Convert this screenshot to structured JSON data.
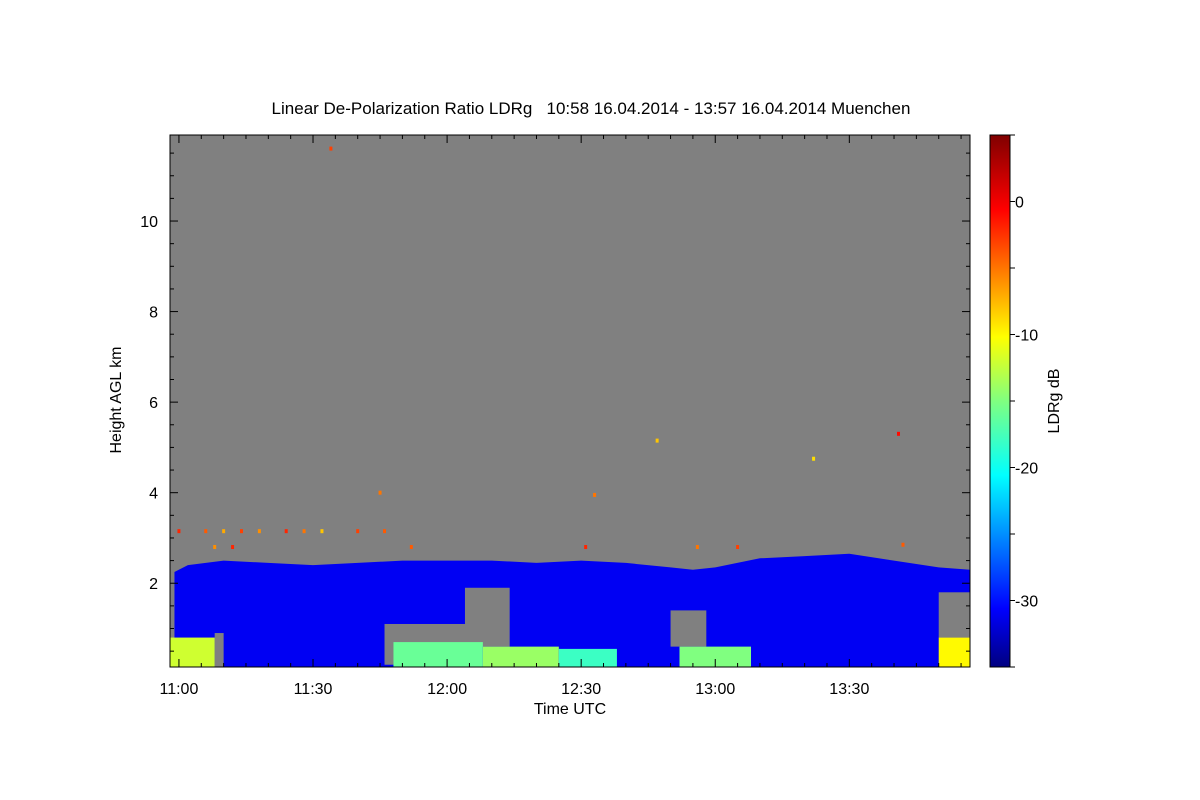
{
  "chart_data": {
    "type": "heatmap",
    "title": "Linear De-Polarization Ratio LDRg   10:58 16.04.2014 - 13:57 16.04.2014 Muenchen",
    "xlabel": "Time UTC",
    "ylabel": "Height AGL km",
    "colorbar_label": "LDRg dB",
    "xlim": [
      "10:58",
      "13:57"
    ],
    "ylim": [
      0.15,
      11.9
    ],
    "x_ticks": [
      "11:00",
      "11:30",
      "12:00",
      "12:30",
      "13:00",
      "13:30"
    ],
    "y_ticks": [
      "2",
      "4",
      "6",
      "8",
      "10"
    ],
    "colorbar_range": [
      -35,
      5
    ],
    "colorbar_ticks": [
      "0",
      "-10",
      "-20",
      "-30"
    ],
    "colormap": "jet",
    "background_color": "#808080",
    "field": {
      "description_units": "LDRg in dB; layer top in km",
      "layer_top_km": [
        {
          "time": "10:58",
          "top": 2.2
        },
        {
          "time": "11:02",
          "top": 2.4
        },
        {
          "time": "11:10",
          "top": 2.5
        },
        {
          "time": "11:20",
          "top": 2.45
        },
        {
          "time": "11:30",
          "top": 2.4
        },
        {
          "time": "11:40",
          "top": 2.45
        },
        {
          "time": "11:50",
          "top": 2.5
        },
        {
          "time": "12:00",
          "top": 2.5
        },
        {
          "time": "12:10",
          "top": 2.5
        },
        {
          "time": "12:20",
          "top": 2.45
        },
        {
          "time": "12:30",
          "top": 2.5
        },
        {
          "time": "12:40",
          "top": 2.45
        },
        {
          "time": "12:50",
          "top": 2.35
        },
        {
          "time": "12:55",
          "top": 2.3
        },
        {
          "time": "13:00",
          "top": 2.35
        },
        {
          "time": "13:10",
          "top": 2.55
        },
        {
          "time": "13:20",
          "top": 2.6
        },
        {
          "time": "13:30",
          "top": 2.65
        },
        {
          "time": "13:40",
          "top": 2.5
        },
        {
          "time": "13:50",
          "top": 2.35
        },
        {
          "time": "13:57",
          "top": 2.3
        }
      ],
      "layer_value_db": -31,
      "surface_layer": [
        {
          "start": "10:58",
          "end": "11:08",
          "top": 0.8,
          "value_db": -12
        },
        {
          "start": "11:48",
          "end": "12:08",
          "top": 0.7,
          "value_db": -16
        },
        {
          "start": "12:08",
          "end": "12:25",
          "top": 0.6,
          "value_db": -14
        },
        {
          "start": "12:25",
          "end": "12:38",
          "top": 0.55,
          "value_db": -18
        },
        {
          "start": "12:52",
          "end": "13:08",
          "top": 0.6,
          "value_db": -15
        },
        {
          "start": "13:50",
          "end": "13:57",
          "top": 0.8,
          "value_db": -10
        }
      ],
      "gaps": [
        {
          "start": "10:58",
          "end": "10:59",
          "bottom": 0.15,
          "top": 2.3
        },
        {
          "start": "11:08",
          "end": "11:10",
          "bottom": 0.15,
          "top": 0.9
        },
        {
          "start": "11:46",
          "end": "12:06",
          "bottom": 0.2,
          "top": 1.1
        },
        {
          "start": "12:04",
          "end": "12:14",
          "bottom": 0.6,
          "top": 1.9
        },
        {
          "start": "12:50",
          "end": "12:58",
          "bottom": 0.6,
          "top": 1.4
        },
        {
          "start": "13:50",
          "end": "13:57",
          "bottom": 0.8,
          "top": 1.8
        }
      ],
      "outliers": [
        {
          "time": "11:34",
          "height": 11.6,
          "value_db": -3
        },
        {
          "time": "12:47",
          "height": 5.15,
          "value_db": -8
        },
        {
          "time": "13:22",
          "height": 4.75,
          "value_db": -9
        },
        {
          "time": "13:41",
          "height": 5.3,
          "value_db": -1
        },
        {
          "time": "11:45",
          "height": 4.0,
          "value_db": -5
        },
        {
          "time": "12:33",
          "height": 3.95,
          "value_db": -5
        },
        {
          "time": "11:00",
          "height": 3.15,
          "value_db": -2
        },
        {
          "time": "11:06",
          "height": 3.15,
          "value_db": -4
        },
        {
          "time": "11:10",
          "height": 3.15,
          "value_db": -7
        },
        {
          "time": "11:14",
          "height": 3.15,
          "value_db": -3
        },
        {
          "time": "11:18",
          "height": 3.15,
          "value_db": -6
        },
        {
          "time": "11:24",
          "height": 3.15,
          "value_db": -2
        },
        {
          "time": "11:28",
          "height": 3.15,
          "value_db": -5
        },
        {
          "time": "11:32",
          "height": 3.15,
          "value_db": -8
        },
        {
          "time": "11:40",
          "height": 3.15,
          "value_db": -3
        },
        {
          "time": "11:46",
          "height": 3.15,
          "value_db": -4
        },
        {
          "time": "11:08",
          "height": 2.8,
          "value_db": -6
        },
        {
          "time": "11:12",
          "height": 2.8,
          "value_db": -2
        },
        {
          "time": "11:52",
          "height": 2.8,
          "value_db": -4
        },
        {
          "time": "12:31",
          "height": 2.8,
          "value_db": -2
        },
        {
          "time": "12:56",
          "height": 2.8,
          "value_db": -5
        },
        {
          "time": "13:05",
          "height": 2.8,
          "value_db": -3
        },
        {
          "time": "13:42",
          "height": 2.85,
          "value_db": -4
        }
      ]
    }
  }
}
